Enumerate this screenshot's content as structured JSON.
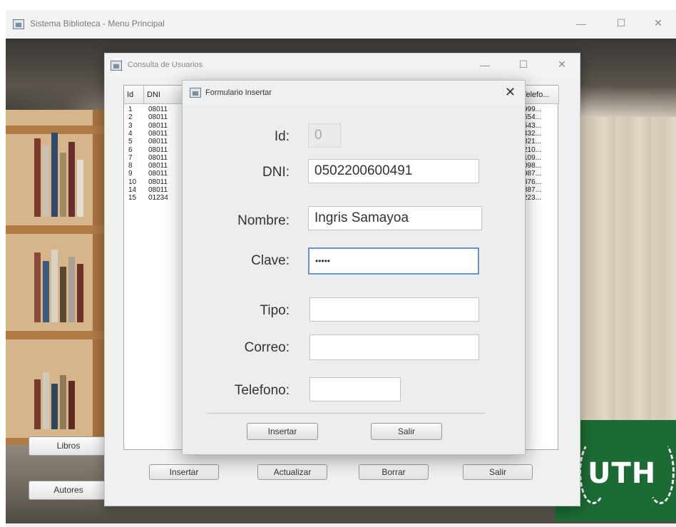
{
  "main_window": {
    "title": "Sistema Biblioteca - Menu Principal",
    "menu_buttons": {
      "libros": "Libros",
      "autores": "Autores"
    },
    "logo_text": "UTH"
  },
  "consulta_window": {
    "title": "Consulta de Usuarios",
    "table": {
      "headers": {
        "id": "Id",
        "dni": "DNI",
        "telefono": "Telefo..."
      },
      "rows": [
        {
          "id": "1",
          "dni": "08011",
          "tel": "999..."
        },
        {
          "id": "2",
          "dni": "08011",
          "tel": "654..."
        },
        {
          "id": "3",
          "dni": "08011",
          "tel": "543..."
        },
        {
          "id": "4",
          "dni": "08011",
          "tel": "432..."
        },
        {
          "id": "5",
          "dni": "08011",
          "tel": "321..."
        },
        {
          "id": "6",
          "dni": "08011",
          "tel": "210..."
        },
        {
          "id": "7",
          "dni": "08011",
          "tel": "109..."
        },
        {
          "id": "8",
          "dni": "08011",
          "tel": "098..."
        },
        {
          "id": "9",
          "dni": "08011",
          "tel": "987..."
        },
        {
          "id": "10",
          "dni": "08011",
          "tel": "876..."
        },
        {
          "id": "14",
          "dni": "08011",
          "tel": "887..."
        },
        {
          "id": "15",
          "dni": "01234",
          "tel": "223..."
        }
      ]
    },
    "buttons": {
      "insertar": "Insertar",
      "actualizar": "Actualizar",
      "borrar": "Borrar",
      "salir": "Salir"
    }
  },
  "form_dialog": {
    "title": "Formulario Insertar",
    "close_glyph": "✕",
    "fields": {
      "id": {
        "label": "Id:",
        "value": "0"
      },
      "dni": {
        "label": "DNI:",
        "value": "0502200600491"
      },
      "nombre": {
        "label": "Nombre:",
        "value": "Ingris Samayoa"
      },
      "clave": {
        "label": "Clave:",
        "value": "•••••"
      },
      "tipo": {
        "label": "Tipo:",
        "value": ""
      },
      "correo": {
        "label": "Correo:",
        "value": ""
      },
      "telefono": {
        "label": "Telefono:",
        "value": ""
      }
    },
    "buttons": {
      "insertar": "Insertar",
      "salir": "Salir"
    }
  },
  "window_controls": {
    "minimize": "—",
    "maximize": "☐",
    "close": "✕"
  },
  "icons": [
    "java-app-icon",
    "minimize-icon",
    "maximize-icon",
    "close-icon"
  ],
  "colors": {
    "logo_green": "#1c6b34",
    "focus_border": "#6c93c4"
  }
}
